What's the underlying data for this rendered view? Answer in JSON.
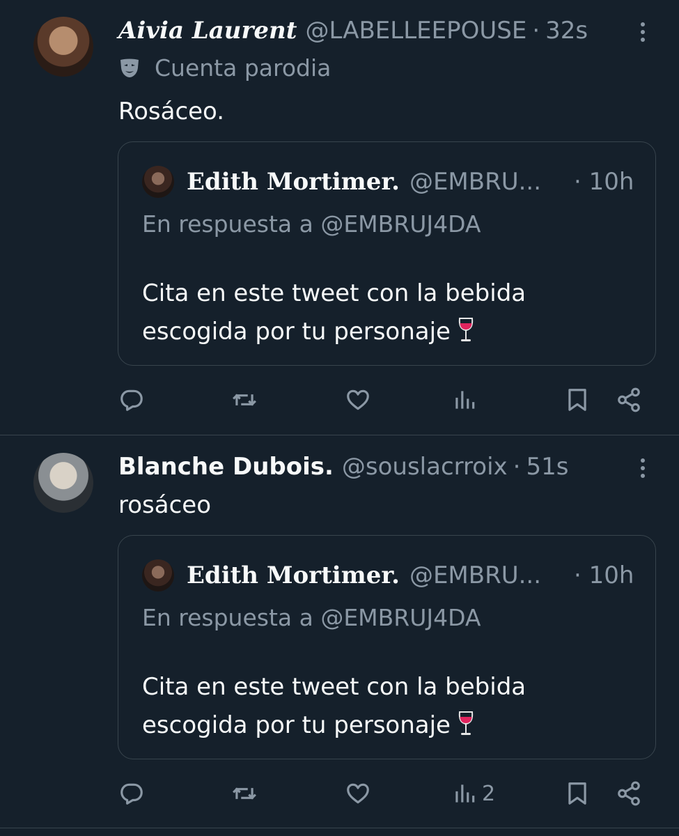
{
  "tweets": [
    {
      "display_name": "Aivia Laurent",
      "handle": "@LABELLEEPOUSE",
      "time": "32s",
      "parody_label": "Cuenta parodia",
      "text": "Rosáceo.",
      "quote": {
        "display_name": "Edith Mortimer.",
        "handle": "@EMBRU...",
        "time": "· 10h",
        "reply_to": "En respuesta a @EMBRUJ4DA",
        "text": "Cita en este tweet con la bebida escogida por tu personaje"
      },
      "views": ""
    },
    {
      "display_name": "Blanche Dubois.",
      "handle": "@souslacrroix",
      "time": "51s",
      "text": "rosáceo",
      "quote": {
        "display_name": "Edith Mortimer.",
        "handle": "@EMBRU...",
        "time": "· 10h",
        "reply_to": "En respuesta a @EMBRUJ4DA",
        "text": "Cita en este tweet con la bebida escogida por tu personaje"
      },
      "views": "2"
    }
  ],
  "icons": {
    "parody": "theater-mask-icon",
    "wine": "wine-glass-icon",
    "reply": "reply-icon",
    "retweet": "retweet-icon",
    "like": "heart-icon",
    "views": "views-chart-icon",
    "bookmark": "bookmark-icon",
    "share": "share-icon",
    "more": "more-vertical-icon"
  },
  "colors": {
    "background": "#15202b",
    "text_primary": "#f7f9f9",
    "text_secondary": "#8b98a5",
    "border": "#38444d",
    "wine": "#e0245e"
  }
}
